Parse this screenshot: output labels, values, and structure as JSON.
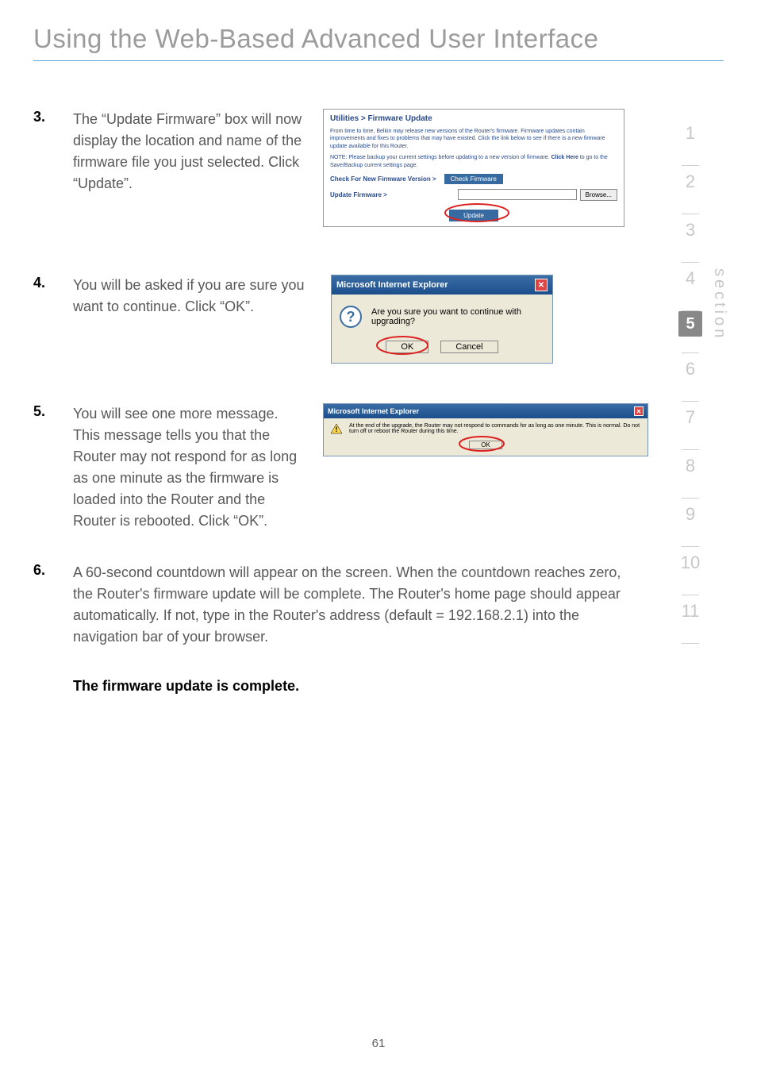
{
  "page": {
    "title": "Using the Web-Based Advanced User Interface",
    "number": "61"
  },
  "sidenav": {
    "label": "section",
    "items": [
      "1",
      "2",
      "3",
      "4",
      "5",
      "6",
      "7",
      "8",
      "9",
      "10",
      "11"
    ],
    "active": "5"
  },
  "steps": {
    "s3": {
      "num": "3.",
      "text": "The “Update Firmware” box will now display the location and name of the firmware file you just selected. Click “Update”."
    },
    "s4": {
      "num": "4.",
      "text": "You will be asked if you are sure you want to continue. Click “OK”."
    },
    "s5": {
      "num": "5.",
      "text": "You will see one more message. This message tells you that the Router may not respond for as long as one minute as the firmware is loaded into the Router and the Router is rebooted. Click “OK”."
    },
    "s6": {
      "num": "6.",
      "text": "A 60-second countdown will appear on the screen. When the countdown reaches zero, the Router's firmware update will be complete. The Router's home page should appear automatically. If not, type in the Router's address (default = 192.168.2.1) into the navigation bar of your browser."
    }
  },
  "completion": "The firmware update is complete.",
  "shot1": {
    "breadcrumb": "Utilities > Firmware Update",
    "p1": "From time to time, Belkin may release new versions of the Router's firmware. Firmware updates contain improvements and fixes to problems that may have existed. Click the link below to see if there is a new firmware update available for this Router.",
    "p2a": "NOTE: Please backup your current settings before updating to a new version of firmware. ",
    "p2b": "Click Here",
    "p2c": " to go to the Save/Backup current settings page.",
    "check_label": "Check For New Firmware Version >",
    "check_btn": "Check Firmware",
    "update_label": "Update Firmware >",
    "browse_btn": "Browse...",
    "update_btn": "Update"
  },
  "shot2": {
    "title": "Microsoft Internet Explorer",
    "msg": "Are you sure you want to continue with upgrading?",
    "ok": "OK",
    "cancel": "Cancel"
  },
  "shot3": {
    "title": "Microsoft Internet Explorer",
    "msg": "At the end of the upgrade, the Router may not respond to commands for as long as one minute. This is normal. Do not turn off or reboot the Router during this time.",
    "ok": "OK"
  }
}
